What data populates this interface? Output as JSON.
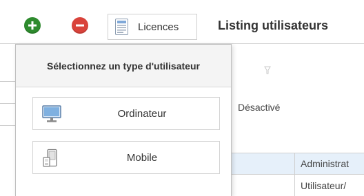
{
  "toolbar": {
    "add_icon": "plus-circle-icon",
    "remove_icon": "minus-circle-icon",
    "licences_label": "Licences",
    "licences_icon": "document-icon",
    "page_title": "Listing utilisateurs",
    "colors": {
      "add": "#2e8b2e",
      "remove": "#d9433b"
    }
  },
  "background": {
    "status_text": "Désactivé",
    "rows": [
      {
        "role": "Administrat"
      },
      {
        "role": "Utilisateur/"
      }
    ],
    "selected_row_color": "#e6f0fa"
  },
  "popup": {
    "title": "Sélectionnez un type d'utilisateur",
    "options": [
      {
        "label": "Ordinateur",
        "icon": "monitor-icon"
      },
      {
        "label": "Mobile",
        "icon": "mobile-phone-icon"
      }
    ]
  }
}
